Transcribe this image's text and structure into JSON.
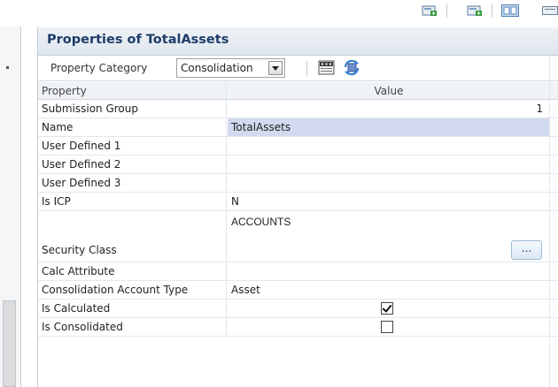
{
  "toolbar": {
    "icons": [
      "add-green-icon",
      "add-green-icon-2",
      "grid-view-icon",
      "view-icon"
    ]
  },
  "panel": {
    "title": "Properties of TotalAssets",
    "category_label": "Property Category",
    "category_value": "Consolidation"
  },
  "grid": {
    "headers": {
      "property": "Property",
      "value": "Value"
    },
    "rows": [
      {
        "property": "Submission Group",
        "value": "1"
      },
      {
        "property": "Name",
        "value": "TotalAssets"
      },
      {
        "property": "User Defined 1",
        "value": ""
      },
      {
        "property": "User Defined 2",
        "value": ""
      },
      {
        "property": "User Defined 3",
        "value": ""
      },
      {
        "property": "Is ICP",
        "value": "N"
      },
      {
        "property": "Security Class",
        "value": "ACCOUNTS",
        "button": "..."
      },
      {
        "property": "Calc Attribute",
        "value": ""
      },
      {
        "property": "Consolidation Account Type",
        "value": "Asset"
      },
      {
        "property": "Is Calculated",
        "checked": true
      },
      {
        "property": "Is Consolidated",
        "checked": false
      }
    ]
  },
  "colors": {
    "title": "#1e3c6a",
    "selected_row": "#d2daf0",
    "header_bg": "#e6ecf2"
  }
}
